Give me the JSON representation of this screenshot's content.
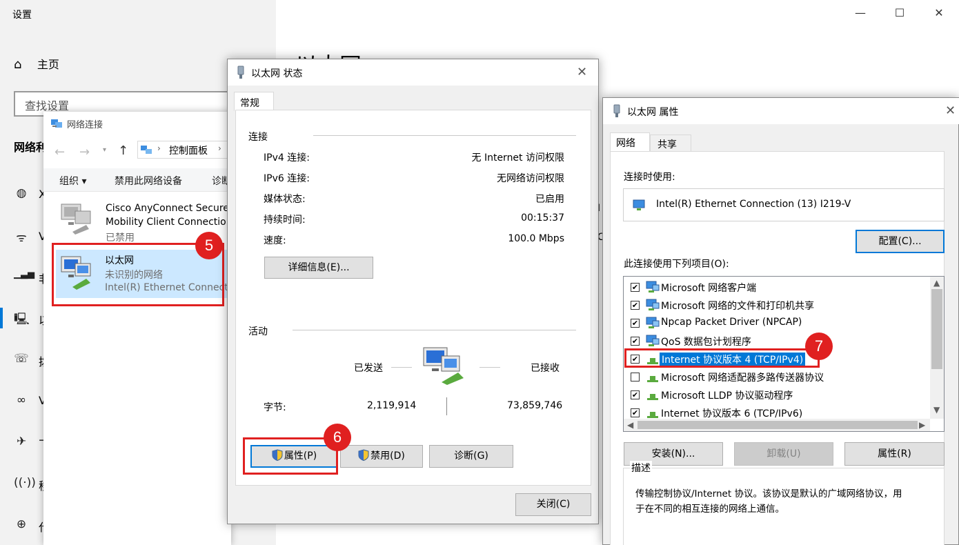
{
  "settings": {
    "title": "设置",
    "home_label": "主页",
    "search_placeholder": "查找设置",
    "section_head_clip": "网络利",
    "page_heading_clip": "以太网",
    "side_letters": [
      "X",
      "V",
      "非",
      "以",
      "拨",
      "V",
      "飞",
      "移",
      "代"
    ]
  },
  "net_connections": {
    "title": "网络连接",
    "breadcrumb_root": "控制面板",
    "toolbar": {
      "organize": "组织 ▾",
      "disable": "禁用此网络设备",
      "diagnose": "诊断"
    },
    "items": [
      {
        "name1": "Cisco AnyConnect Secure",
        "name2": "Mobility Client Connection",
        "status": "已禁用"
      },
      {
        "name1": "以太网",
        "status": "未识别的网络",
        "device": "Intel(R) Ethernet Connection"
      }
    ],
    "side_clip_letters": [
      "I",
      "C"
    ]
  },
  "status_dialog": {
    "title": "以太网 状态",
    "tab": "常规",
    "group_connection": "连接",
    "rows": [
      {
        "label": "IPv4 连接:",
        "value": "无 Internet 访问权限"
      },
      {
        "label": "IPv6 连接:",
        "value": "无网络访问权限"
      },
      {
        "label": "媒体状态:",
        "value": "已启用"
      },
      {
        "label": "持续时间:",
        "value": "00:15:37"
      },
      {
        "label": "速度:",
        "value": "100.0 Mbps"
      }
    ],
    "details_button": "详细信息(E)...",
    "group_activity": "活动",
    "sent_label": "已发送",
    "received_label": "已接收",
    "bytes_label": "字节:",
    "bytes_sent": "2,119,914",
    "bytes_received": "73,859,746",
    "properties_button": "属性(P)",
    "disable_button": "禁用(D)",
    "diagnose_button": "诊断(G)",
    "close_button": "关闭(C)"
  },
  "properties_dialog": {
    "title": "以太网 属性",
    "tabs": [
      "网络",
      "共享"
    ],
    "connect_using_label": "连接时使用:",
    "adapter_name": "Intel(R) Ethernet Connection (13) I219-V",
    "configure_button": "配置(C)...",
    "items_label": "此连接使用下列项目(O):",
    "items": [
      {
        "label": "Microsoft 网络客户端",
        "checked": true
      },
      {
        "label": "Microsoft 网络的文件和打印机共享",
        "checked": true
      },
      {
        "label": "Npcap Packet Driver (NPCAP)",
        "checked": true
      },
      {
        "label": "QoS 数据包计划程序",
        "checked": true
      },
      {
        "label": "Internet 协议版本 4 (TCP/IPv4)",
        "checked": true,
        "selected": true
      },
      {
        "label": "Microsoft 网络适配器多路传送器协议",
        "checked": false
      },
      {
        "label": "Microsoft LLDP 协议驱动程序",
        "checked": true
      },
      {
        "label": "Internet 协议版本 6 (TCP/IPv6)",
        "checked": true
      }
    ],
    "install_button": "安装(N)...",
    "uninstall_button": "卸载(U)",
    "properties_button": "属性(R)",
    "description_label": "描述",
    "description_line1": "传输控制协议/Internet 协议。该协议是默认的广域网络协议，用",
    "description_line2": "于在不同的相互连接的网络上通信。"
  },
  "annotations": {
    "step5": "5",
    "step6": "6",
    "step7": "7"
  },
  "colors": {
    "accent": "#0078d7",
    "highlight_red": "#e02020",
    "selection_bg": "#cce8ff"
  }
}
